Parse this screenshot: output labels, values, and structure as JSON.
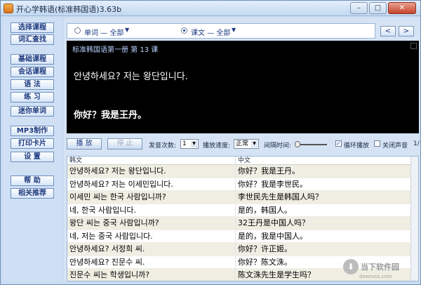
{
  "window": {
    "title": "开心学韩语(标准韩国语)3.63b",
    "min_label": "–",
    "max_label": "□",
    "close_label": "✕"
  },
  "sidebar": {
    "items": [
      {
        "label": "选择课程"
      },
      {
        "label": "词汇查找"
      },
      {
        "label": "基础课程"
      },
      {
        "label": "会话课程"
      },
      {
        "label": "语  法"
      },
      {
        "label": "练  习"
      },
      {
        "label": "迷你单词"
      },
      {
        "label": "MP3制作"
      },
      {
        "label": "打印卡片"
      },
      {
        "label": "设  置"
      },
      {
        "label": "帮  助"
      },
      {
        "label": "相关推荐"
      }
    ]
  },
  "filter": {
    "word_label": "单词 — 全部",
    "text_label": "课文 — 全部",
    "prev_label": "<",
    "next_label": ">"
  },
  "display": {
    "lesson_title": "标准韩国语第一册 第 13 课",
    "korean": "안녕하세요? 저는 왕단입니다.",
    "chinese": "你好？我是王丹。"
  },
  "controls": {
    "play_label": "播 放",
    "stop_label": "停 止",
    "repeat_label": "发音次数:",
    "repeat_value": "1",
    "speed_label": "播放速度:",
    "speed_value": "正常",
    "interval_label": "间隔时间:",
    "loop_label": "循环播放",
    "loop_checked": "✓",
    "mute_label": "关闭声音",
    "page_indicator": "1/"
  },
  "table": {
    "headers": [
      "韩文",
      "中文"
    ],
    "rows": [
      [
        "안녕하세요? 저는 왕단입니다.",
        "你好？我是王丹。"
      ],
      [
        "안녕하세요? 저는 이세민입니다.",
        "你好？我是李世民。"
      ],
      [
        "이세민 씨는 한국 사람입니까?",
        "李世民先生是韩国人吗？"
      ],
      [
        "네, 한국 사람입니다.",
        "是的，韩国人。"
      ],
      [
        "왕단 씨는 중국 사람입니까?",
        "32王丹是中国人吗？"
      ],
      [
        "네, 저는 중국 사람입니다.",
        "是的，我是中国人。"
      ],
      [
        "안녕하세요? 서정희 씨.",
        "你好？许正姬。"
      ],
      [
        "안녕하세요? 진문수 씨.",
        "你好？陈文洙。"
      ],
      [
        "진문수 씨는 학생입니까?",
        "陈文洙先生是学生吗？"
      ]
    ]
  },
  "watermark": {
    "icon": "download-arrow-icon",
    "name": "当下软件园",
    "domain": "downxia.com"
  }
}
